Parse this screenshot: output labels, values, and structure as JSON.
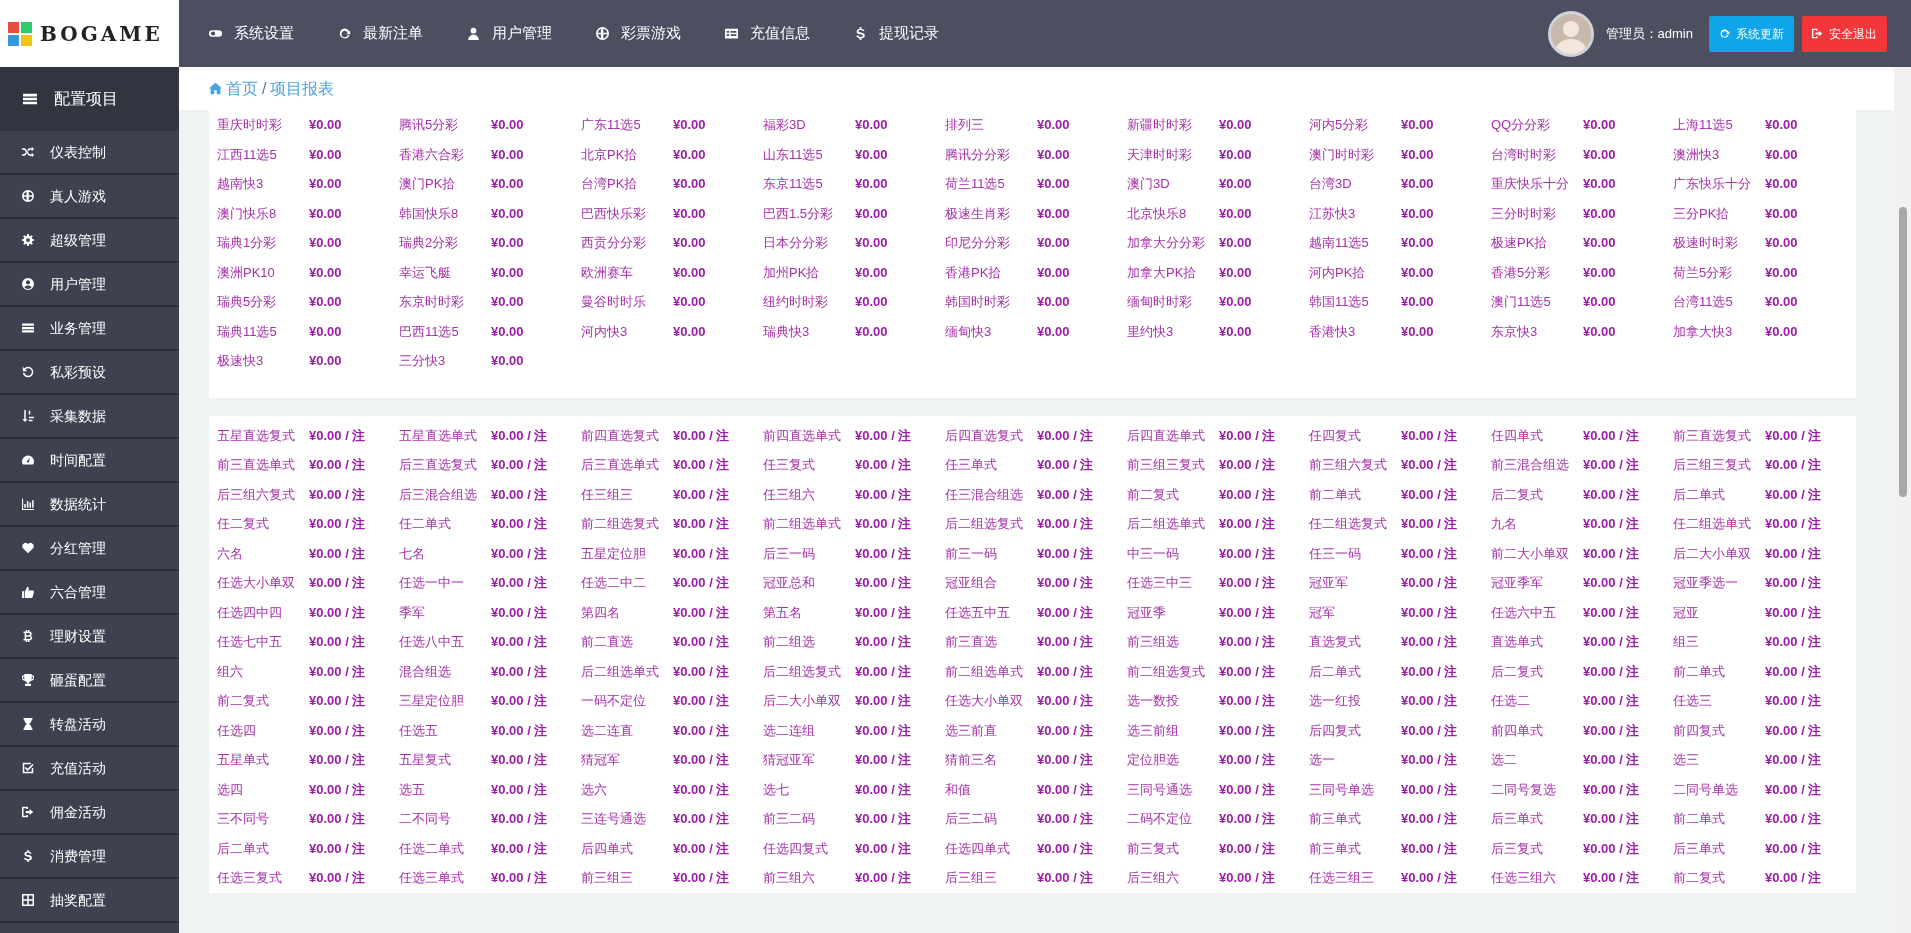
{
  "brand": {
    "name": "BOGAME"
  },
  "top_nav": [
    {
      "label": "系统设置"
    },
    {
      "label": "最新注单"
    },
    {
      "label": "用户管理"
    },
    {
      "label": "彩票游戏"
    },
    {
      "label": "充值信息"
    },
    {
      "label": "提现记录"
    }
  ],
  "user": {
    "label": "管理员：admin"
  },
  "buttons": [
    {
      "label": "系统更新",
      "kind": "update"
    },
    {
      "label": "安全退出",
      "kind": "logout"
    }
  ],
  "sidebar": {
    "title": "配置项目",
    "items": [
      {
        "label": "仪表控制"
      },
      {
        "label": "真人游戏"
      },
      {
        "label": "超级管理"
      },
      {
        "label": "用户管理"
      },
      {
        "label": "业务管理"
      },
      {
        "label": "私彩预设"
      },
      {
        "label": "采集数据"
      },
      {
        "label": "时间配置"
      },
      {
        "label": "数据统计"
      },
      {
        "label": "分红管理"
      },
      {
        "label": "六合管理"
      },
      {
        "label": "理财设置"
      },
      {
        "label": "砸蛋配置"
      },
      {
        "label": "转盘活动"
      },
      {
        "label": "充值活动"
      },
      {
        "label": "佣金活动"
      },
      {
        "label": "消费管理"
      },
      {
        "label": "抽奖配置"
      }
    ]
  },
  "breadcrumb": {
    "separator": "/",
    "items": [
      {
        "label": "首页"
      },
      {
        "label": "项目报表"
      }
    ]
  },
  "panels": [
    {
      "items": [
        {
          "name": "重庆时时彩",
          "value": "¥0.00"
        },
        {
          "name": "腾讯5分彩",
          "value": "¥0.00"
        },
        {
          "name": "广东11选5",
          "value": "¥0.00"
        },
        {
          "name": "福彩3D",
          "value": "¥0.00"
        },
        {
          "name": "排列三",
          "value": "¥0.00"
        },
        {
          "name": "新疆时时彩",
          "value": "¥0.00"
        },
        {
          "name": "河内5分彩",
          "value": "¥0.00"
        },
        {
          "name": "QQ分分彩",
          "value": "¥0.00"
        },
        {
          "name": "上海11选5",
          "value": "¥0.00"
        },
        {
          "name": "江西11选5",
          "value": "¥0.00"
        },
        {
          "name": "香港六合彩",
          "value": "¥0.00"
        },
        {
          "name": "北京PK拾",
          "value": "¥0.00"
        },
        {
          "name": "山东11选5",
          "value": "¥0.00"
        },
        {
          "name": "腾讯分分彩",
          "value": "¥0.00"
        },
        {
          "name": "天津时时彩",
          "value": "¥0.00"
        },
        {
          "name": "澳门时时彩",
          "value": "¥0.00"
        },
        {
          "name": "台湾时时彩",
          "value": "¥0.00"
        },
        {
          "name": "澳洲快3",
          "value": "¥0.00"
        },
        {
          "name": "越南快3",
          "value": "¥0.00"
        },
        {
          "name": "澳门PK拾",
          "value": "¥0.00"
        },
        {
          "name": "台湾PK拾",
          "value": "¥0.00"
        },
        {
          "name": "东京11选5",
          "value": "¥0.00"
        },
        {
          "name": "荷兰11选5",
          "value": "¥0.00"
        },
        {
          "name": "澳门3D",
          "value": "¥0.00"
        },
        {
          "name": "台湾3D",
          "value": "¥0.00"
        },
        {
          "name": "重庆快乐十分",
          "value": "¥0.00"
        },
        {
          "name": "广东快乐十分",
          "value": "¥0.00"
        },
        {
          "name": "澳门快乐8",
          "value": "¥0.00"
        },
        {
          "name": "韩国快乐8",
          "value": "¥0.00"
        },
        {
          "name": "巴西快乐彩",
          "value": "¥0.00"
        },
        {
          "name": "巴西1.5分彩",
          "value": "¥0.00"
        },
        {
          "name": "极速生肖彩",
          "value": "¥0.00"
        },
        {
          "name": "北京快乐8",
          "value": "¥0.00"
        },
        {
          "name": "江苏快3",
          "value": "¥0.00"
        },
        {
          "name": "三分时时彩",
          "value": "¥0.00"
        },
        {
          "name": "三分PK拾",
          "value": "¥0.00"
        },
        {
          "name": "瑞典1分彩",
          "value": "¥0.00"
        },
        {
          "name": "瑞典2分彩",
          "value": "¥0.00"
        },
        {
          "name": "西贡分分彩",
          "value": "¥0.00"
        },
        {
          "name": "日本分分彩",
          "value": "¥0.00"
        },
        {
          "name": "印尼分分彩",
          "value": "¥0.00"
        },
        {
          "name": "加拿大分分彩",
          "value": "¥0.00"
        },
        {
          "name": "越南11选5",
          "value": "¥0.00"
        },
        {
          "name": "极速PK拾",
          "value": "¥0.00"
        },
        {
          "name": "极速时时彩",
          "value": "¥0.00"
        },
        {
          "name": "澳洲PK10",
          "value": "¥0.00"
        },
        {
          "name": "幸运飞艇",
          "value": "¥0.00"
        },
        {
          "name": "欧洲赛车",
          "value": "¥0.00"
        },
        {
          "name": "加州PK拾",
          "value": "¥0.00"
        },
        {
          "name": "香港PK拾",
          "value": "¥0.00"
        },
        {
          "name": "加拿大PK拾",
          "value": "¥0.00"
        },
        {
          "name": "河内PK拾",
          "value": "¥0.00"
        },
        {
          "name": "香港5分彩",
          "value": "¥0.00"
        },
        {
          "name": "荷兰5分彩",
          "value": "¥0.00"
        },
        {
          "name": "瑞典5分彩",
          "value": "¥0.00"
        },
        {
          "name": "东京时时彩",
          "value": "¥0.00"
        },
        {
          "name": "曼谷时时乐",
          "value": "¥0.00"
        },
        {
          "name": "纽约时时彩",
          "value": "¥0.00"
        },
        {
          "name": "韩国时时彩",
          "value": "¥0.00"
        },
        {
          "name": "缅甸时时彩",
          "value": "¥0.00"
        },
        {
          "name": "韩国11选5",
          "value": "¥0.00"
        },
        {
          "name": "澳门11选5",
          "value": "¥0.00"
        },
        {
          "name": "台湾11选5",
          "value": "¥0.00"
        },
        {
          "name": "瑞典11选5",
          "value": "¥0.00"
        },
        {
          "name": "巴西11选5",
          "value": "¥0.00"
        },
        {
          "name": "河内快3",
          "value": "¥0.00"
        },
        {
          "name": "瑞典快3",
          "value": "¥0.00"
        },
        {
          "name": "缅甸快3",
          "value": "¥0.00"
        },
        {
          "name": "里约快3",
          "value": "¥0.00"
        },
        {
          "name": "香港快3",
          "value": "¥0.00"
        },
        {
          "name": "东京快3",
          "value": "¥0.00"
        },
        {
          "name": "加拿大快3",
          "value": "¥0.00"
        },
        {
          "name": "极速快3",
          "value": "¥0.00"
        },
        {
          "name": "三分快3",
          "value": "¥0.00"
        }
      ]
    },
    {
      "items": [
        {
          "name": "五星直选复式",
          "value": "¥0.00 / 注"
        },
        {
          "name": "五星直选单式",
          "value": "¥0.00 / 注"
        },
        {
          "name": "前四直选复式",
          "value": "¥0.00 / 注"
        },
        {
          "name": "前四直选单式",
          "value": "¥0.00 / 注"
        },
        {
          "name": "后四直选复式",
          "value": "¥0.00 / 注"
        },
        {
          "name": "后四直选单式",
          "value": "¥0.00 / 注"
        },
        {
          "name": "任四复式",
          "value": "¥0.00 / 注"
        },
        {
          "name": "任四单式",
          "value": "¥0.00 / 注"
        },
        {
          "name": "前三直选复式",
          "value": "¥0.00 / 注"
        },
        {
          "name": "前三直选单式",
          "value": "¥0.00 / 注"
        },
        {
          "name": "后三直选复式",
          "value": "¥0.00 / 注"
        },
        {
          "name": "后三直选单式",
          "value": "¥0.00 / 注"
        },
        {
          "name": "任三复式",
          "value": "¥0.00 / 注"
        },
        {
          "name": "任三单式",
          "value": "¥0.00 / 注"
        },
        {
          "name": "前三组三复式",
          "value": "¥0.00 / 注"
        },
        {
          "name": "前三组六复式",
          "value": "¥0.00 / 注"
        },
        {
          "name": "前三混合组选",
          "value": "¥0.00 / 注"
        },
        {
          "name": "后三组三复式",
          "value": "¥0.00 / 注"
        },
        {
          "name": "后三组六复式",
          "value": "¥0.00 / 注"
        },
        {
          "name": "后三混合组选",
          "value": "¥0.00 / 注"
        },
        {
          "name": "任三组三",
          "value": "¥0.00 / 注"
        },
        {
          "name": "任三组六",
          "value": "¥0.00 / 注"
        },
        {
          "name": "任三混合组选",
          "value": "¥0.00 / 注"
        },
        {
          "name": "前二复式",
          "value": "¥0.00 / 注"
        },
        {
          "name": "前二单式",
          "value": "¥0.00 / 注"
        },
        {
          "name": "后二复式",
          "value": "¥0.00 / 注"
        },
        {
          "name": "后二单式",
          "value": "¥0.00 / 注"
        },
        {
          "name": "任二复式",
          "value": "¥0.00 / 注"
        },
        {
          "name": "任二单式",
          "value": "¥0.00 / 注"
        },
        {
          "name": "前二组选复式",
          "value": "¥0.00 / 注"
        },
        {
          "name": "前二组选单式",
          "value": "¥0.00 / 注"
        },
        {
          "name": "后二组选复式",
          "value": "¥0.00 / 注"
        },
        {
          "name": "后二组选单式",
          "value": "¥0.00 / 注"
        },
        {
          "name": "任二组选复式",
          "value": "¥0.00 / 注"
        },
        {
          "name": "九名",
          "value": "¥0.00 / 注"
        },
        {
          "name": "任二组选单式",
          "value": "¥0.00 / 注"
        },
        {
          "name": "六名",
          "value": "¥0.00 / 注"
        },
        {
          "name": "七名",
          "value": "¥0.00 / 注"
        },
        {
          "name": "五星定位胆",
          "value": "¥0.00 / 注"
        },
        {
          "name": "后三一码",
          "value": "¥0.00 / 注"
        },
        {
          "name": "前三一码",
          "value": "¥0.00 / 注"
        },
        {
          "name": "中三一码",
          "value": "¥0.00 / 注"
        },
        {
          "name": "任三一码",
          "value": "¥0.00 / 注"
        },
        {
          "name": "前二大小单双",
          "value": "¥0.00 / 注"
        },
        {
          "name": "后二大小单双",
          "value": "¥0.00 / 注"
        },
        {
          "name": "任选大小单双",
          "value": "¥0.00 / 注"
        },
        {
          "name": "任选一中一",
          "value": "¥0.00 / 注"
        },
        {
          "name": "任选二中二",
          "value": "¥0.00 / 注"
        },
        {
          "name": "冠亚总和",
          "value": "¥0.00 / 注"
        },
        {
          "name": "冠亚组合",
          "value": "¥0.00 / 注"
        },
        {
          "name": "任选三中三",
          "value": "¥0.00 / 注"
        },
        {
          "name": "冠亚军",
          "value": "¥0.00 / 注"
        },
        {
          "name": "冠亚季军",
          "value": "¥0.00 / 注"
        },
        {
          "name": "冠亚季选一",
          "value": "¥0.00 / 注"
        },
        {
          "name": "任选四中四",
          "value": "¥0.00 / 注"
        },
        {
          "name": "季军",
          "value": "¥0.00 / 注"
        },
        {
          "name": "第四名",
          "value": "¥0.00 / 注"
        },
        {
          "name": "第五名",
          "value": "¥0.00 / 注"
        },
        {
          "name": "任选五中五",
          "value": "¥0.00 / 注"
        },
        {
          "name": "冠亚季",
          "value": "¥0.00 / 注"
        },
        {
          "name": "冠军",
          "value": "¥0.00 / 注"
        },
        {
          "name": "任选六中五",
          "value": "¥0.00 / 注"
        },
        {
          "name": "冠亚",
          "value": "¥0.00 / 注"
        },
        {
          "name": "任选七中五",
          "value": "¥0.00 / 注"
        },
        {
          "name": "任选八中五",
          "value": "¥0.00 / 注"
        },
        {
          "name": "前二直选",
          "value": "¥0.00 / 注"
        },
        {
          "name": "前二组选",
          "value": "¥0.00 / 注"
        },
        {
          "name": "前三直选",
          "value": "¥0.00 / 注"
        },
        {
          "name": "前三组选",
          "value": "¥0.00 / 注"
        },
        {
          "name": "直选复式",
          "value": "¥0.00 / 注"
        },
        {
          "name": "直选单式",
          "value": "¥0.00 / 注"
        },
        {
          "name": "组三",
          "value": "¥0.00 / 注"
        },
        {
          "name": "组六",
          "value": "¥0.00 / 注"
        },
        {
          "name": "混合组选",
          "value": "¥0.00 / 注"
        },
        {
          "name": "后二组选单式",
          "value": "¥0.00 / 注"
        },
        {
          "name": "后二组选复式",
          "value": "¥0.00 / 注"
        },
        {
          "name": "前二组选单式",
          "value": "¥0.00 / 注"
        },
        {
          "name": "前二组选复式",
          "value": "¥0.00 / 注"
        },
        {
          "name": "后二单式",
          "value": "¥0.00 / 注"
        },
        {
          "name": "后二复式",
          "value": "¥0.00 / 注"
        },
        {
          "name": "前二单式",
          "value": "¥0.00 / 注"
        },
        {
          "name": "前二复式",
          "value": "¥0.00 / 注"
        },
        {
          "name": "三星定位胆",
          "value": "¥0.00 / 注"
        },
        {
          "name": "一码不定位",
          "value": "¥0.00 / 注"
        },
        {
          "name": "后二大小单双",
          "value": "¥0.00 / 注"
        },
        {
          "name": "任选大小单双",
          "value": "¥0.00 / 注"
        },
        {
          "name": "选一数投",
          "value": "¥0.00 / 注"
        },
        {
          "name": "选一红投",
          "value": "¥0.00 / 注"
        },
        {
          "name": "任选二",
          "value": "¥0.00 / 注"
        },
        {
          "name": "任选三",
          "value": "¥0.00 / 注"
        },
        {
          "name": "任选四",
          "value": "¥0.00 / 注"
        },
        {
          "name": "任选五",
          "value": "¥0.00 / 注"
        },
        {
          "name": "选二连直",
          "value": "¥0.00 / 注"
        },
        {
          "name": "选二连组",
          "value": "¥0.00 / 注"
        },
        {
          "name": "选三前直",
          "value": "¥0.00 / 注"
        },
        {
          "name": "选三前组",
          "value": "¥0.00 / 注"
        },
        {
          "name": "后四复式",
          "value": "¥0.00 / 注"
        },
        {
          "name": "前四单式",
          "value": "¥0.00 / 注"
        },
        {
          "name": "前四复式",
          "value": "¥0.00 / 注"
        },
        {
          "name": "五星单式",
          "value": "¥0.00 / 注"
        },
        {
          "name": "五星复式",
          "value": "¥0.00 / 注"
        },
        {
          "name": "猜冠军",
          "value": "¥0.00 / 注"
        },
        {
          "name": "猜冠亚军",
          "value": "¥0.00 / 注"
        },
        {
          "name": "猜前三名",
          "value": "¥0.00 / 注"
        },
        {
          "name": "定位胆选",
          "value": "¥0.00 / 注"
        },
        {
          "name": "选一",
          "value": "¥0.00 / 注"
        },
        {
          "name": "选二",
          "value": "¥0.00 / 注"
        },
        {
          "name": "选三",
          "value": "¥0.00 / 注"
        },
        {
          "name": "选四",
          "value": "¥0.00 / 注"
        },
        {
          "name": "选五",
          "value": "¥0.00 / 注"
        },
        {
          "name": "选六",
          "value": "¥0.00 / 注"
        },
        {
          "name": "选七",
          "value": "¥0.00 / 注"
        },
        {
          "name": "和值",
          "value": "¥0.00 / 注"
        },
        {
          "name": "三同号通选",
          "value": "¥0.00 / 注"
        },
        {
          "name": "三同号单选",
          "value": "¥0.00 / 注"
        },
        {
          "name": "二同号复选",
          "value": "¥0.00 / 注"
        },
        {
          "name": "二同号单选",
          "value": "¥0.00 / 注"
        },
        {
          "name": "三不同号",
          "value": "¥0.00 / 注"
        },
        {
          "name": "二不同号",
          "value": "¥0.00 / 注"
        },
        {
          "name": "三连号通选",
          "value": "¥0.00 / 注"
        },
        {
          "name": "前三二码",
          "value": "¥0.00 / 注"
        },
        {
          "name": "后三二码",
          "value": "¥0.00 / 注"
        },
        {
          "name": "二码不定位",
          "value": "¥0.00 / 注"
        },
        {
          "name": "前三单式",
          "value": "¥0.00 / 注"
        },
        {
          "name": "后三单式",
          "value": "¥0.00 / 注"
        },
        {
          "name": "前二单式",
          "value": "¥0.00 / 注"
        },
        {
          "name": "后二单式",
          "value": "¥0.00 / 注"
        },
        {
          "name": "任选二单式",
          "value": "¥0.00 / 注"
        },
        {
          "name": "后四单式",
          "value": "¥0.00 / 注"
        },
        {
          "name": "任选四复式",
          "value": "¥0.00 / 注"
        },
        {
          "name": "任选四单式",
          "value": "¥0.00 / 注"
        },
        {
          "name": "前三复式",
          "value": "¥0.00 / 注"
        },
        {
          "name": "前三单式",
          "value": "¥0.00 / 注"
        },
        {
          "name": "后三复式",
          "value": "¥0.00 / 注"
        },
        {
          "name": "后三单式",
          "value": "¥0.00 / 注"
        },
        {
          "name": "任选三复式",
          "value": "¥0.00 / 注"
        },
        {
          "name": "任选三单式",
          "value": "¥0.00 / 注"
        },
        {
          "name": "前三组三",
          "value": "¥0.00 / 注"
        },
        {
          "name": "前三组六",
          "value": "¥0.00 / 注"
        },
        {
          "name": "后三组三",
          "value": "¥0.00 / 注"
        },
        {
          "name": "后三组六",
          "value": "¥0.00 / 注"
        },
        {
          "name": "任选三组三",
          "value": "¥0.00 / 注"
        },
        {
          "name": "任选三组六",
          "value": "¥0.00 / 注"
        },
        {
          "name": "前二复式",
          "value": "¥0.00 / 注"
        }
      ]
    }
  ]
}
